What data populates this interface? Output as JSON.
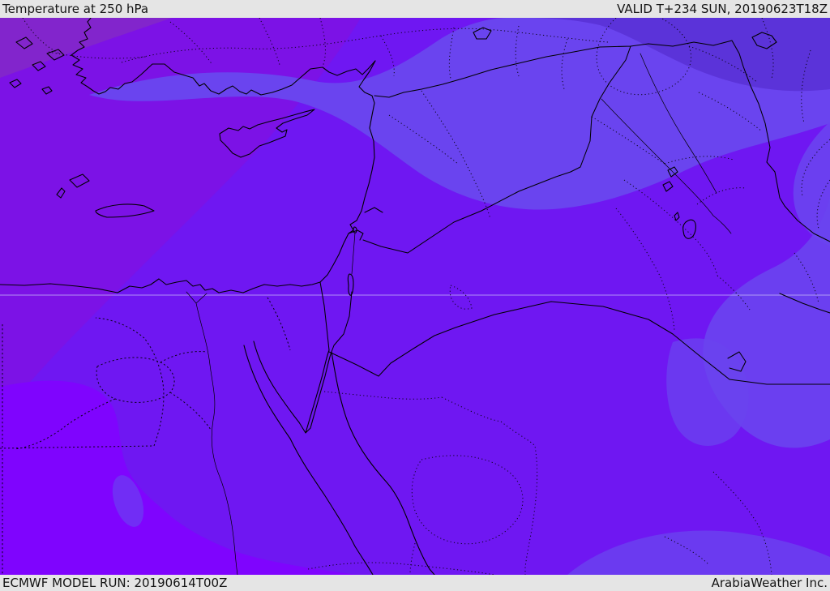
{
  "header": {
    "title": "Temperature at 250 hPa",
    "valid_label": "VALID T+234 SUN, 20190623T18Z"
  },
  "footer": {
    "model_run_label": "ECMWF MODEL RUN: 20190614T00Z",
    "credit_label": "ArabiaWeather Inc."
  },
  "colors": {
    "bar_background": "#e5e5e5",
    "bar_text": "#141414",
    "line_black": "#000000",
    "temp_base": "#6F17F2",
    "temp_bright_southwest": "#7F04FE",
    "temp_upper_left": "#7C12E6",
    "temp_muted_corner": "#8328C9",
    "temp_cool_band": "#6A44EF",
    "temp_cool_dark": "#5B33D9",
    "latitude_line": "#CDC2F8"
  }
}
